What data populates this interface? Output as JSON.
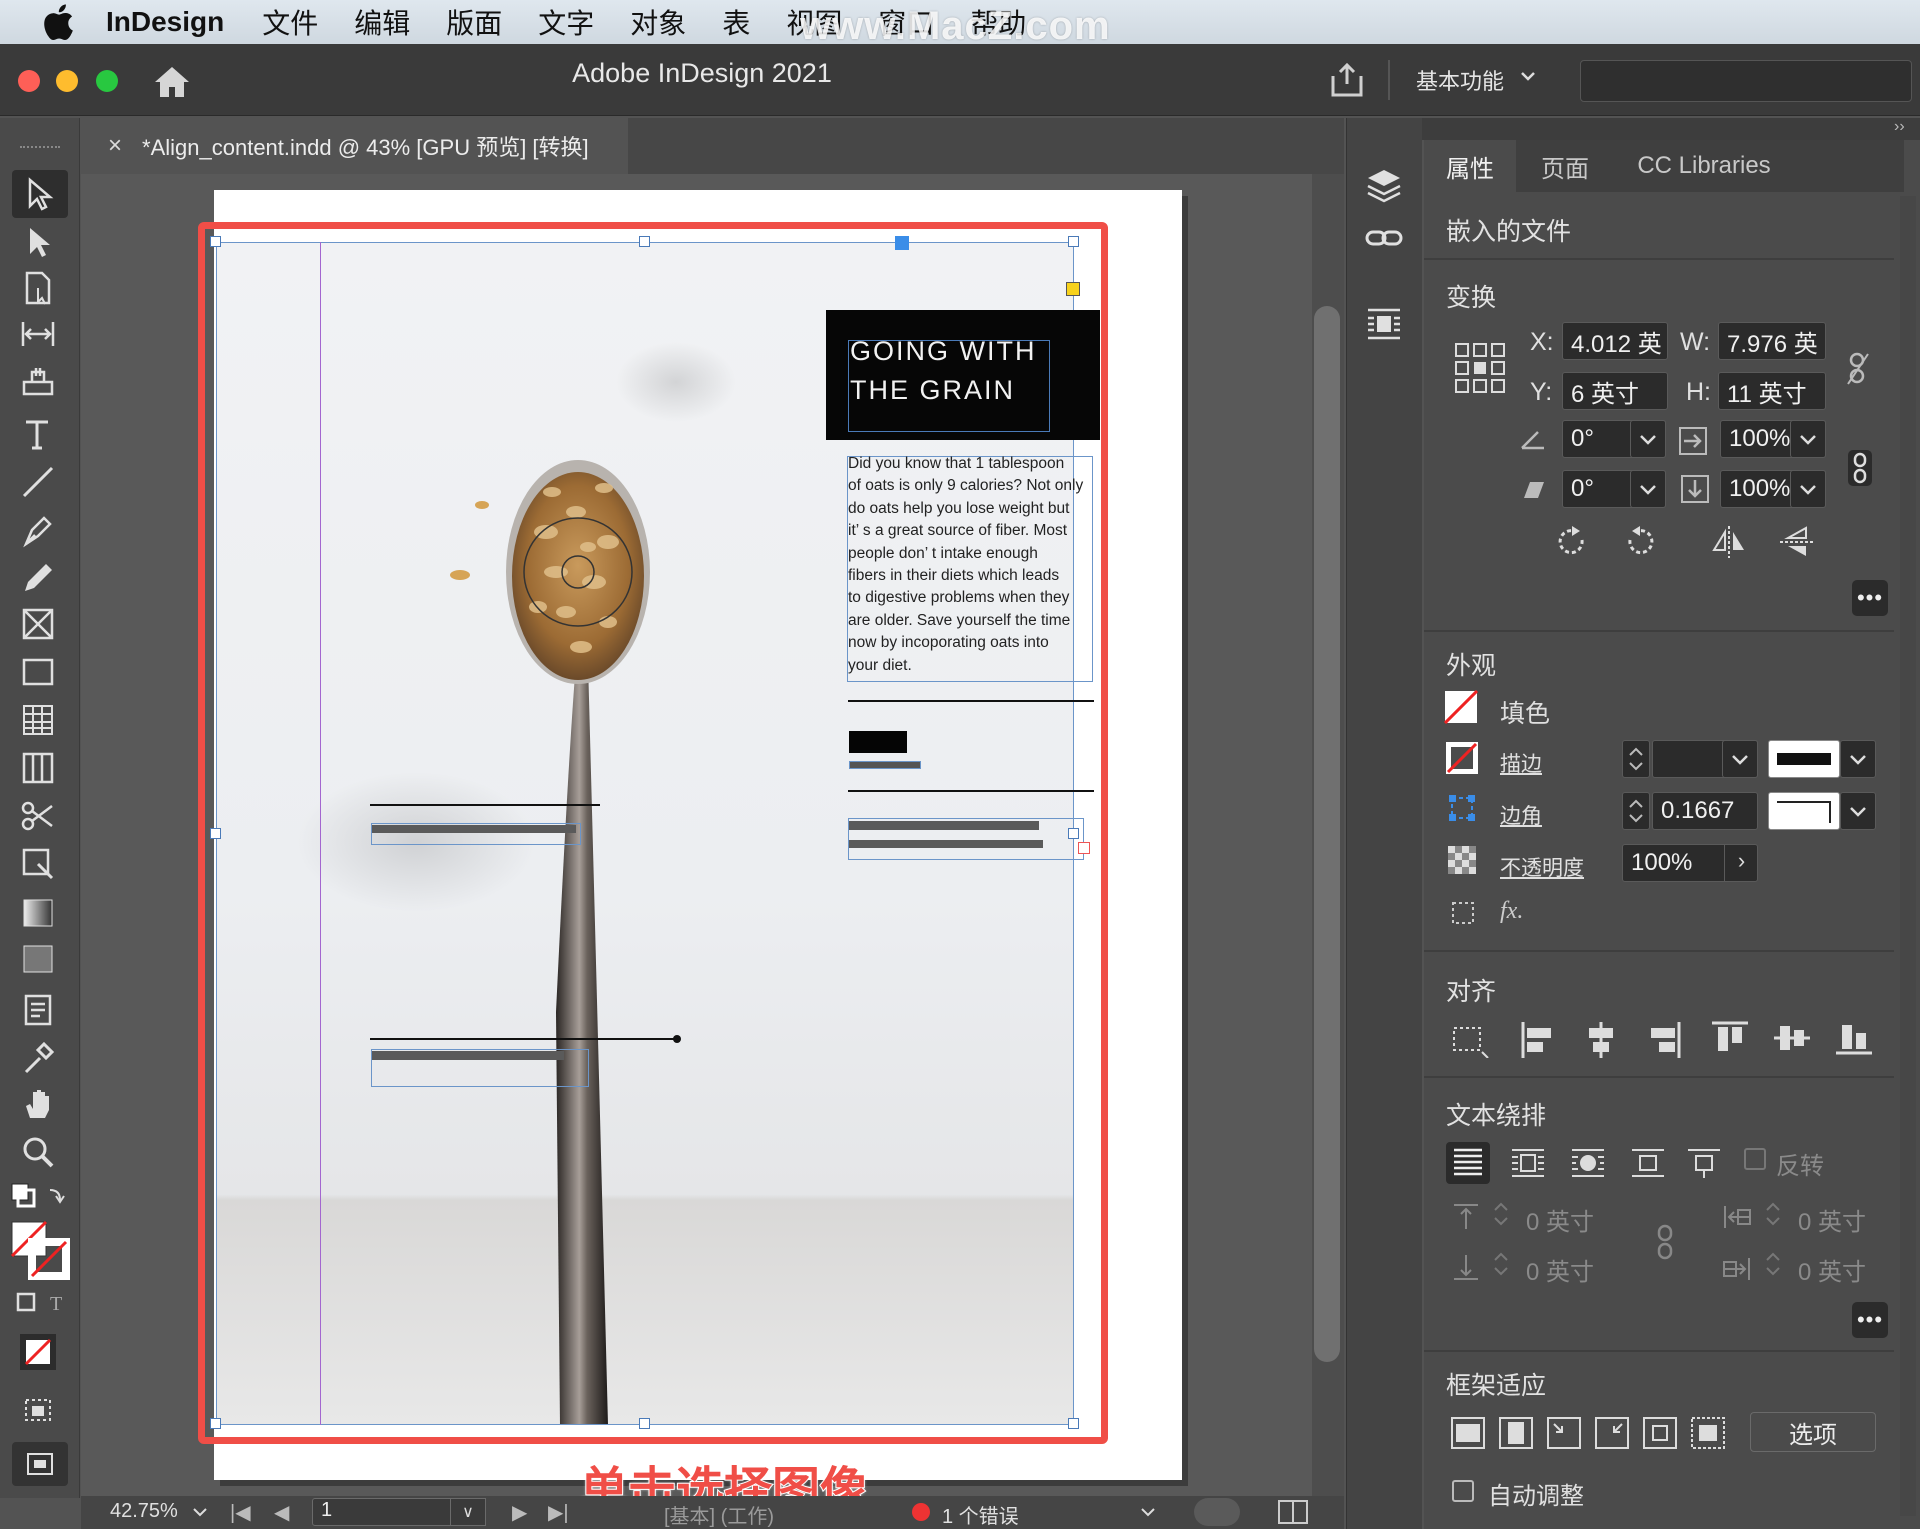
{
  "menubar": {
    "app_name": "InDesign",
    "items": [
      "文件",
      "编辑",
      "版面",
      "文字",
      "对象",
      "表",
      "视图",
      "窗口",
      "帮助"
    ],
    "watermark": "www.MacZ.com"
  },
  "window": {
    "title": "Adobe InDesign 2021",
    "workspace": "基本功能",
    "traffic_colors": [
      "#fe5f57",
      "#febc2e",
      "#28c840"
    ]
  },
  "document_tab": {
    "close_glyph": "×",
    "label": "*Align_content.indd @ 43% [GPU 预览] [转换]"
  },
  "document": {
    "title_line1": "GOING WITH",
    "title_line2": "THE GRAIN",
    "body_lines": [
      "Did you know that 1 tablespoon",
      "of oats is only 9 calories? Not only",
      "do oats help you lose weight but",
      "it’ s a great source of fiber. Most",
      "people don’ t intake enough",
      "fibers in their diets which leads",
      "to digestive problems when they",
      "are older. Save yourself the time",
      "now by incoporating oats into",
      "your diet."
    ],
    "callout": "单击选择图像",
    "accent_color": "#f04e47"
  },
  "statusbar": {
    "zoom": "42.75%",
    "page": "1",
    "style": "[基本] (工作)",
    "errors": "1 个错误"
  },
  "panel": {
    "tabs": [
      "属性",
      "页面",
      "CC Libraries"
    ],
    "header": "嵌入的文件",
    "transform": {
      "title": "变换",
      "x_label": "X:",
      "x": "4.012 英",
      "w_label": "W:",
      "w": "7.976 英",
      "y_label": "Y:",
      "y": "6 英寸",
      "h_label": "H:",
      "h": "11 英寸",
      "rotate": "0°",
      "shear": "0°",
      "scale_x": "100%",
      "scale_y": "100%"
    },
    "appearance": {
      "title": "外观",
      "fill": "填色",
      "stroke": "描边",
      "corner": "边角",
      "corner_value": "0.1667",
      "opacity": "不透明度",
      "opacity_value": "100%",
      "fx": "fx."
    },
    "align": {
      "title": "对齐"
    },
    "text_wrap": {
      "title": "文本绕排",
      "invert": "反转",
      "top": "0 英寸",
      "bottom": "0 英寸",
      "left": "0 英寸",
      "right": "0 英寸"
    },
    "frame_fitting": {
      "title": "框架适应",
      "options": "选项",
      "auto_fit": "自动调整"
    }
  }
}
